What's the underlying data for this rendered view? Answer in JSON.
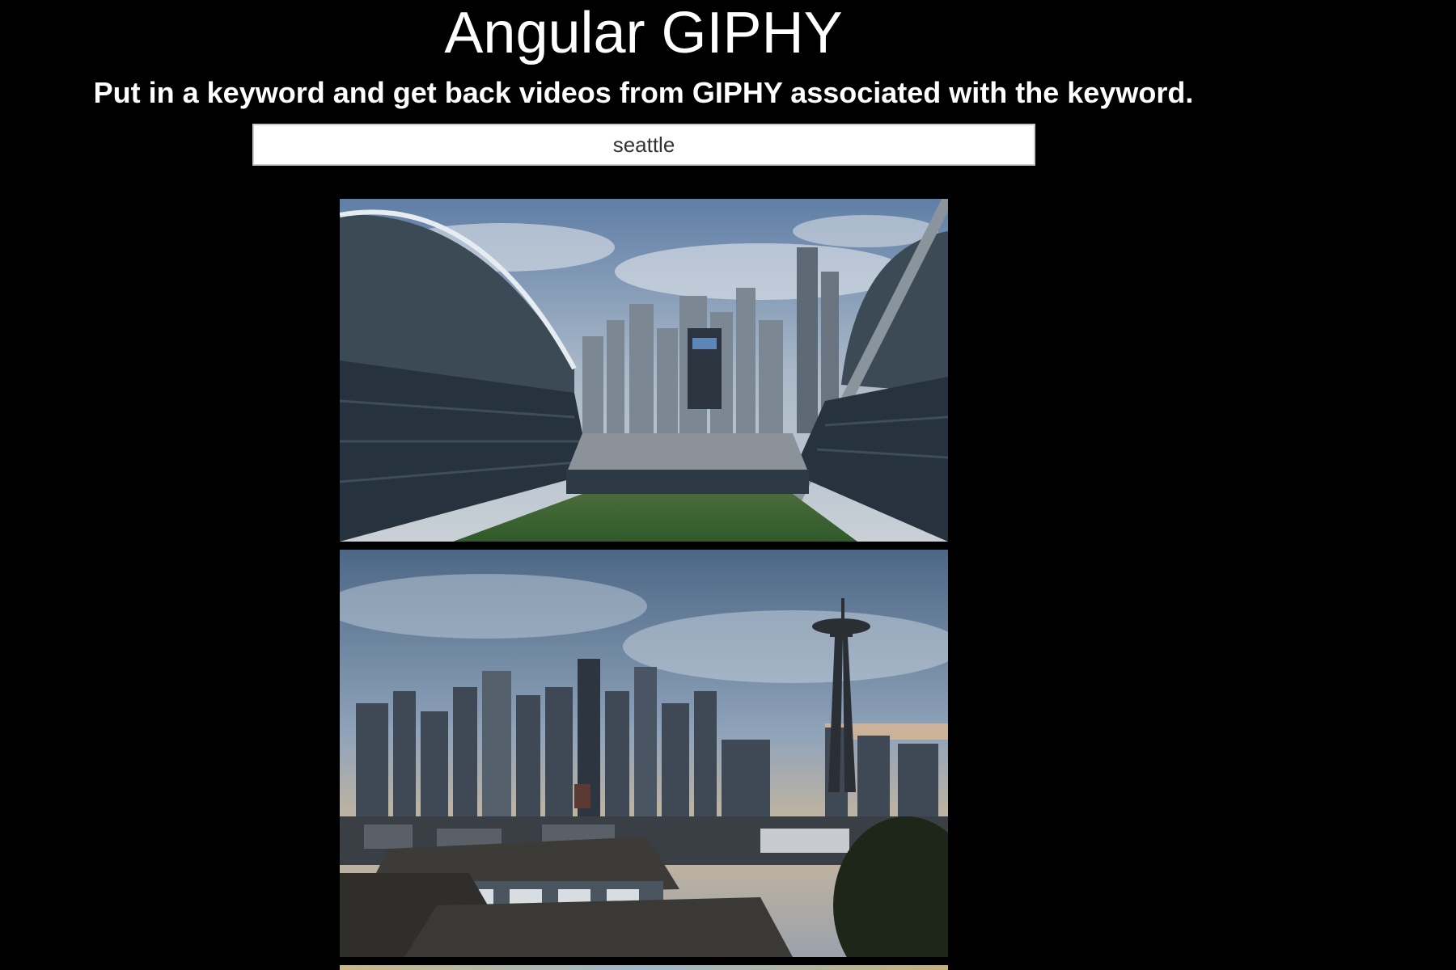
{
  "header": {
    "title": "Angular GIPHY",
    "subtitle": "Put in a keyword and get back videos from GIPHY associated with the keyword."
  },
  "search": {
    "value": "seattle",
    "placeholder": ""
  },
  "results": [
    {
      "subject": "stadium overlooking seattle skyline"
    },
    {
      "subject": "seattle skyline with space needle and houses"
    },
    {
      "subject": "partially visible gif"
    }
  ],
  "colors": {
    "background": "#000000",
    "text": "#ffffff",
    "input_border": "#c9c9c9"
  }
}
